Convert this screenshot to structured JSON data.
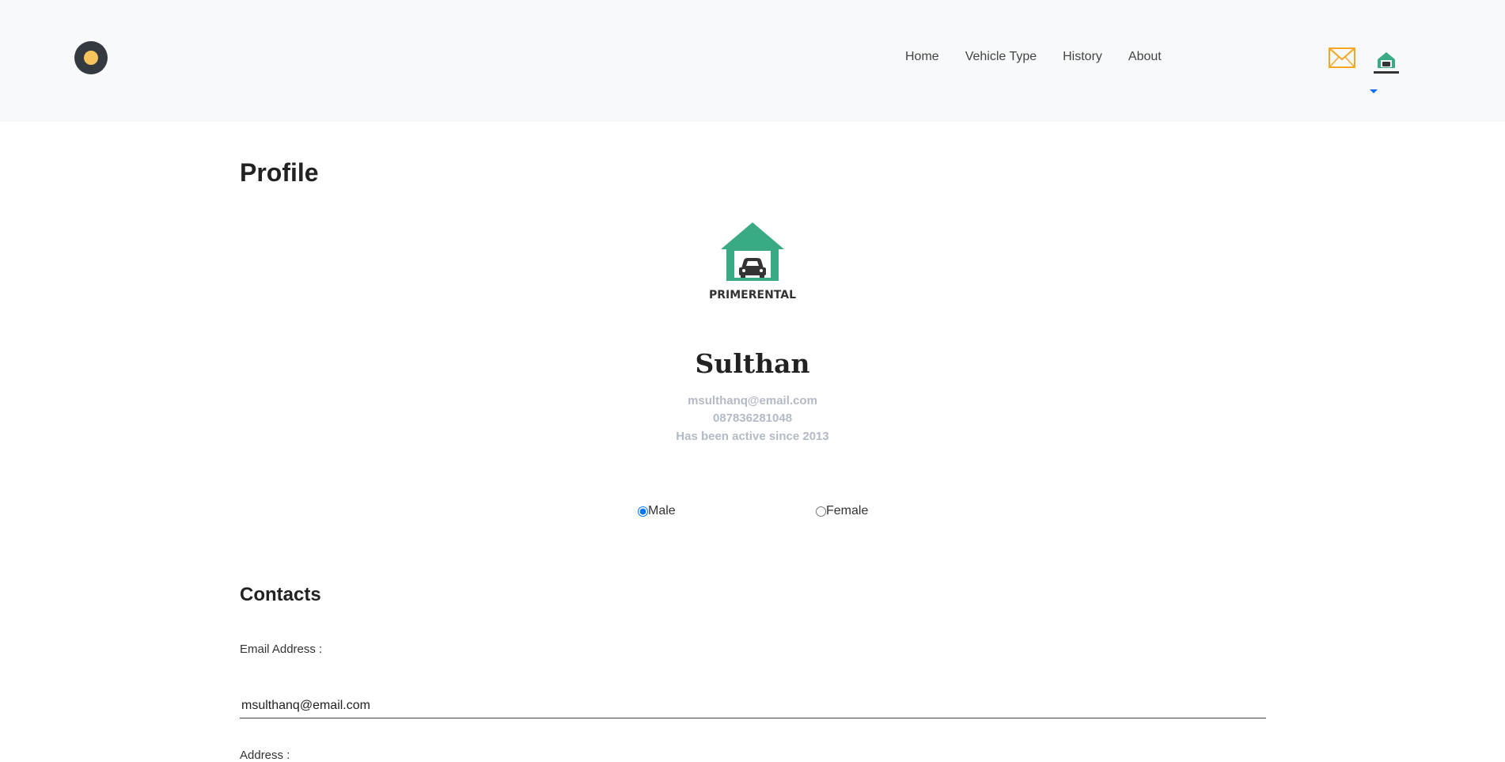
{
  "nav": {
    "links": [
      "Home",
      "Vehicle Type",
      "History",
      "About"
    ]
  },
  "brand": {
    "name": "PRIMERENTAL",
    "accent": "#3aaa85"
  },
  "profile": {
    "title": "Profile",
    "name": "Sulthan",
    "email": "msulthanq@email.com",
    "phone": "087836281048",
    "active_since": "Has been active since 2013"
  },
  "gender": {
    "options": [
      "Male",
      "Female"
    ],
    "selected": "Male"
  },
  "contacts": {
    "title": "Contacts",
    "email_label": "Email Address :",
    "email_value": "msulthanq@email.com",
    "address_label": "Address :"
  },
  "colors": {
    "navbar_bg": "#f8f9fa",
    "mail_icon": "#f5a623",
    "muted_text": "#b3bac6",
    "caret": "#0d6efd"
  }
}
